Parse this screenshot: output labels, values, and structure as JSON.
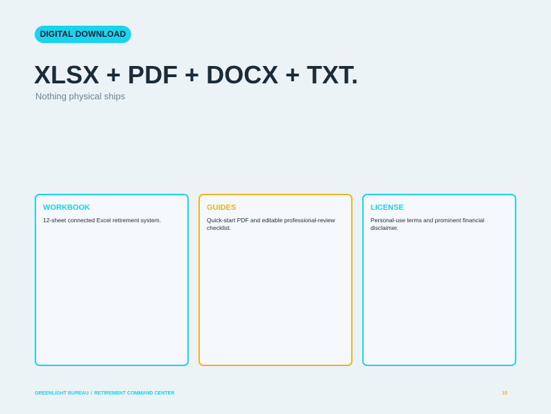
{
  "badge": {
    "label": "DIGITAL DOWNLOAD"
  },
  "headline": "XLSX + PDF + DOCX + TXT.",
  "subtitle": "Nothing physical ships",
  "cards": [
    {
      "title": "WORKBOOK",
      "description": "12-sheet connected Excel retirement system.",
      "accent": "#1CD3EF"
    },
    {
      "title": "GUIDES",
      "description": "Quick-start PDF and editable professional-review checklist.",
      "accent": "#F2B21C"
    },
    {
      "title": "LICENSE",
      "description": "Personal-use terms and prominent financial disclaimer.",
      "accent": "#1CD3EF"
    }
  ],
  "footer": {
    "brand": "GREENLIGHT BUREAU",
    "separator": "/",
    "product": "RETIREMENT COMMAND CENTER",
    "page_number": "10"
  },
  "colors": {
    "background": "#ECF3F7",
    "cyan": "#1CD3EF",
    "amber": "#F2B21C",
    "heading": "#1A2B3A"
  }
}
